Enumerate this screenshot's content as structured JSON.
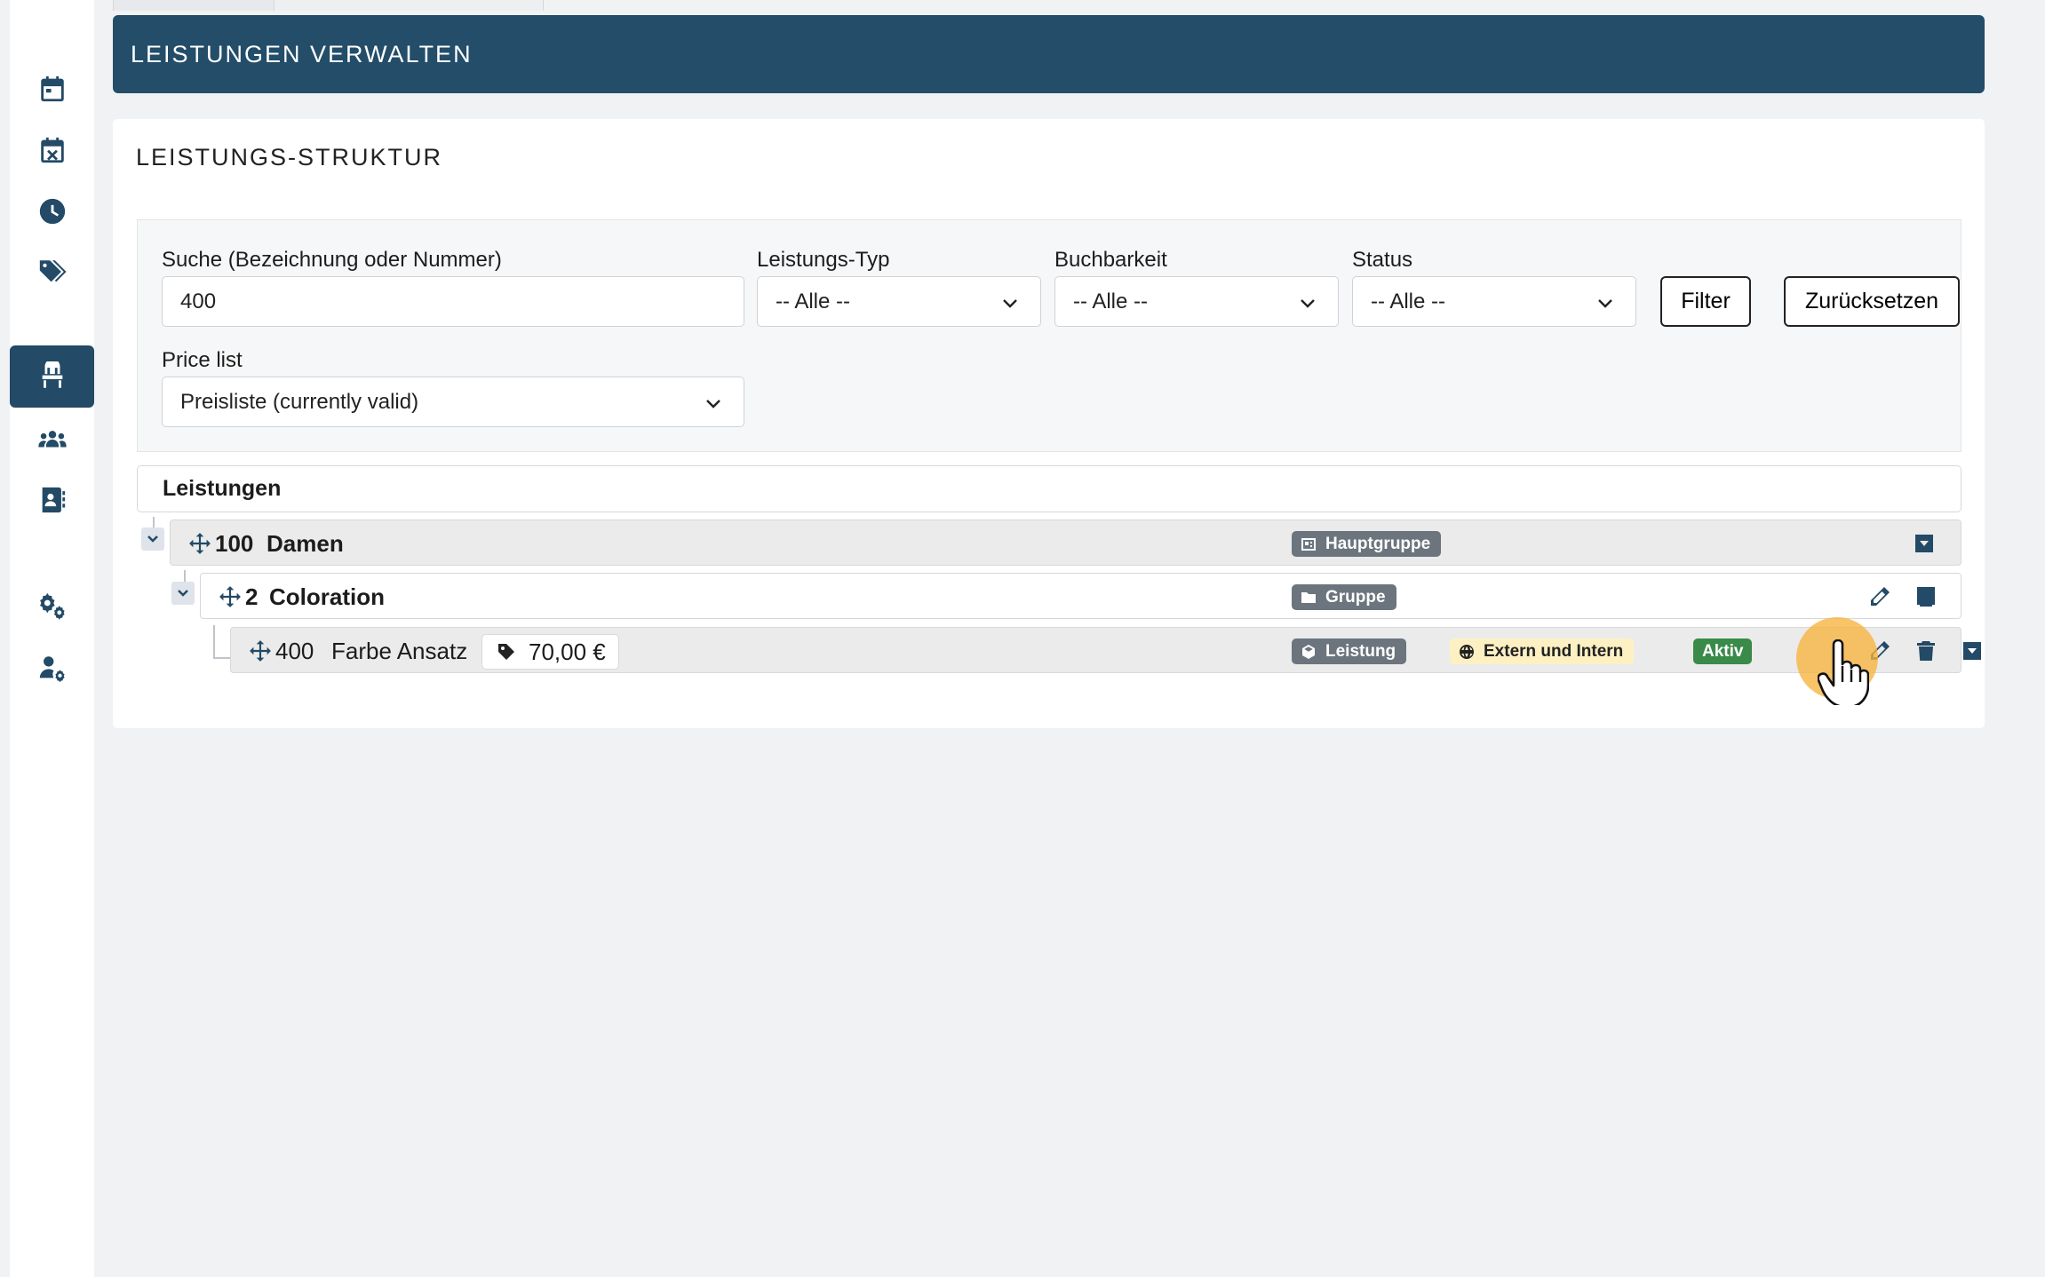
{
  "sidebar": {
    "items": [
      {
        "name": "calendar-icon",
        "active": false
      },
      {
        "name": "calendar-cancel-icon",
        "active": false
      },
      {
        "name": "clock-icon",
        "active": false
      },
      {
        "name": "tags-icon",
        "active": false
      },
      {
        "name": "chair-icon",
        "active": true
      },
      {
        "name": "users-icon",
        "active": false
      },
      {
        "name": "contact-book-icon",
        "active": false
      },
      {
        "name": "cogs-icon",
        "active": false
      },
      {
        "name": "user-settings-icon",
        "active": false
      }
    ]
  },
  "header": {
    "title": "LEISTUNGEN VERWALTEN"
  },
  "card": {
    "title": "LEISTUNGS-STRUKTUR"
  },
  "filters": {
    "search_label": "Suche (Bezeichnung oder Nummer)",
    "search_value": "400",
    "type_label": "Leistungs-Typ",
    "type_value": "-- Alle --",
    "bookability_label": "Buchbarkeit",
    "bookability_value": "-- Alle --",
    "status_label": "Status",
    "status_value": "-- Alle --",
    "filter_button": "Filter",
    "reset_button": "Zurücksetzen",
    "pricelist_label": "Price list",
    "pricelist_value": "Preisliste (currently valid)"
  },
  "tree": {
    "header": "Leistungen",
    "rows": [
      {
        "number": "100",
        "name": "Damen",
        "badge": "Hauptgruppe"
      },
      {
        "number": "2",
        "name": "Coloration",
        "badge": "Gruppe"
      },
      {
        "number": "400",
        "name": "Farbe Ansatz",
        "price": "70,00 €",
        "badge": "Leistung",
        "visibility": "Extern und Intern",
        "status": "Aktiv"
      }
    ]
  },
  "colors": {
    "primary": "#234d68",
    "badge_grey": "#6c757d",
    "badge_yellow": "#fdf1c3",
    "badge_green": "#3a8a4a",
    "cursor_highlight": "#f6b43c"
  }
}
